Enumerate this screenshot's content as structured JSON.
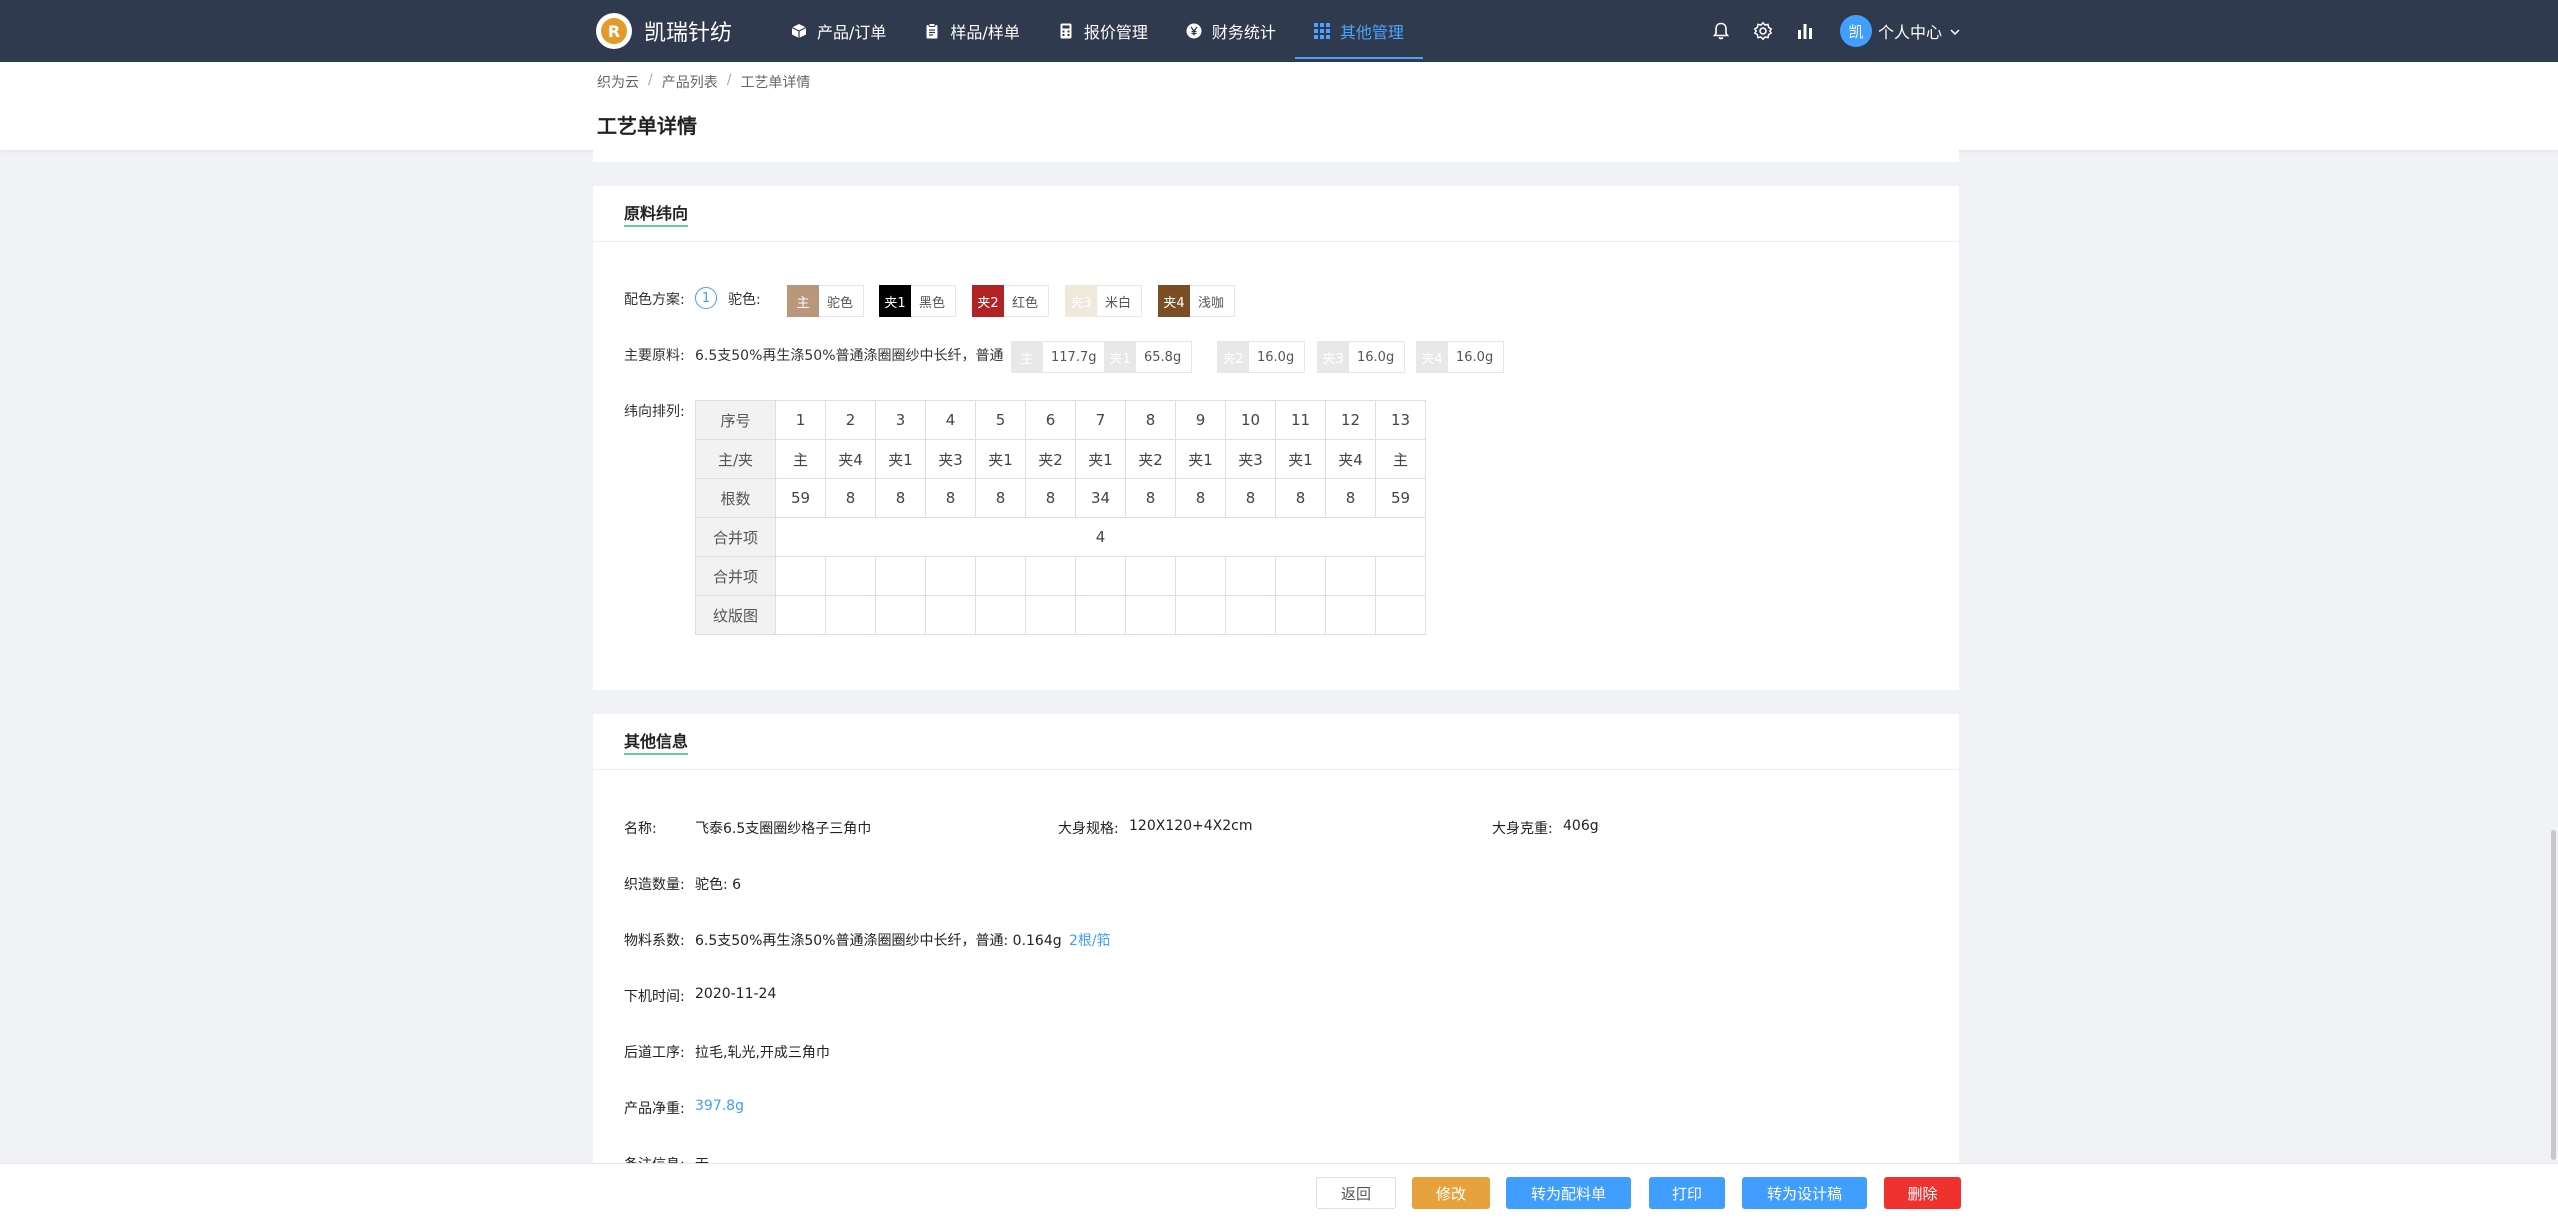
{
  "nav": {
    "brand": "凯瑞针纺",
    "logo_letter": "R",
    "menu": [
      {
        "label": "产品/订单",
        "icon": "cube-icon"
      },
      {
        "label": "样品/样单",
        "icon": "clipboard-icon"
      },
      {
        "label": "报价管理",
        "icon": "calculator-icon"
      },
      {
        "label": "财务统计",
        "icon": "yen-coin-icon"
      },
      {
        "label": "其他管理",
        "icon": "grid-icon",
        "active": true
      }
    ],
    "avatar_text": "凯",
    "user_center": "个人中心"
  },
  "breadcrumb": [
    "织为云",
    "产品列表",
    "工艺单详情"
  ],
  "page_title": "工艺单详情",
  "weft_section": {
    "title": "原料纬向",
    "color_scheme_label": "配色方案:",
    "scheme_number": "1",
    "scheme_name": "驼色:",
    "colors": [
      {
        "tag": "主",
        "name": "驼色",
        "color": "#b8977a",
        "text_color": "#ffffff"
      },
      {
        "tag": "夹1",
        "name": "黑色",
        "color": "#000000",
        "text_color": "#ffffff"
      },
      {
        "tag": "夹2",
        "name": "红色",
        "color": "#b22222",
        "text_color": "#ffffff"
      },
      {
        "tag": "夹3",
        "name": "米白",
        "color": "#efe9dc",
        "text_color": "#ffffff"
      },
      {
        "tag": "夹4",
        "name": "浅咖",
        "color": "#7a4e24",
        "text_color": "#ffffff"
      }
    ],
    "main_material_label": "主要原料:",
    "main_material": "6.5支50%再生涤50%普通涤圈圈纱中长纤，普通",
    "material_weights": [
      {
        "tag": "主",
        "weight": "117.7g"
      },
      {
        "tag": "夹1",
        "weight": "65.8g"
      },
      {
        "tag": "夹2",
        "weight": "16.0g"
      },
      {
        "tag": "夹3",
        "weight": "16.0g"
      },
      {
        "tag": "夹4",
        "weight": "16.0g"
      }
    ],
    "arrangement_label": "纬向排列:",
    "table": {
      "header_label": "序号",
      "indices": [
        "1",
        "2",
        "3",
        "4",
        "5",
        "6",
        "7",
        "8",
        "9",
        "10",
        "11",
        "12",
        "13"
      ],
      "type_label": "主/夹",
      "types": [
        "主",
        "夹4",
        "夹1",
        "夹3",
        "夹1",
        "夹2",
        "夹1",
        "夹2",
        "夹1",
        "夹3",
        "夹1",
        "夹4",
        "主"
      ],
      "count_label": "根数",
      "counts": [
        "59",
        "8",
        "8",
        "8",
        "8",
        "8",
        "34",
        "8",
        "8",
        "8",
        "8",
        "8",
        "59"
      ],
      "merge1_label": "合并项",
      "merge1_value": "4",
      "merge2_label": "合并项",
      "pattern_label": "纹版图"
    }
  },
  "other_section": {
    "title": "其他信息",
    "name_label": "名称:",
    "name_value": "飞泰6.5支圈圈纱格子三角巾",
    "size_label": "大身规格:",
    "size_value": "120X120+4X2cm",
    "weight_label": "大身克重:",
    "weight_value": "406g",
    "qty_label": "织造数量:",
    "qty_value": "驼色: 6",
    "coef_label": "物料系数:",
    "coef_value": "6.5支50%再生涤50%普通涤圈圈纱中长纤，普通: 0.164g",
    "coef_link": "2根/筘",
    "date_label": "下机时间:",
    "date_value": "2020-11-24",
    "process_label": "后道工序:",
    "process_value": "拉毛,轧光,开成三角巾",
    "net_label": "产品净重:",
    "net_value": "397.8g",
    "remark_label": "备注信息:",
    "remark_value": "无"
  },
  "actions": {
    "back": "返回",
    "edit": "修改",
    "to_material": "转为配料单",
    "print": "打印",
    "to_design": "转为设计稿",
    "delete": "删除"
  }
}
